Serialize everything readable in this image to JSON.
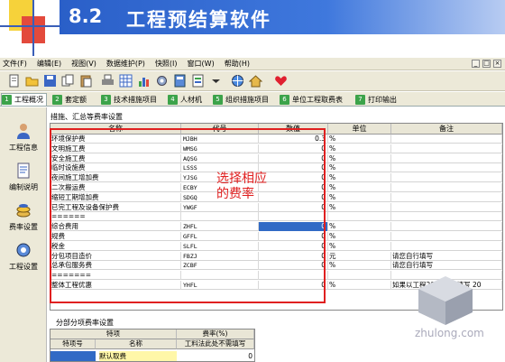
{
  "slide": {
    "number": "8.2",
    "title": "工程预结算软件"
  },
  "menu": [
    "文件(F)",
    "编辑(E)",
    "视图(V)",
    "数据维护(P)",
    "快照(I)",
    "窗口(W)",
    "帮助(H)"
  ],
  "window_controls": [
    "_",
    "□",
    "×"
  ],
  "tabs": [
    {
      "num": "1",
      "label": "工程概况"
    },
    {
      "num": "2",
      "label": "套定额"
    },
    {
      "num": "3",
      "label": "技术措施项目"
    },
    {
      "num": "4",
      "label": "人材机"
    },
    {
      "num": "5",
      "label": "组织措施项目"
    },
    {
      "num": "6",
      "label": "单位工程取费表"
    },
    {
      "num": "7",
      "label": "打印输出"
    }
  ],
  "sidebar": [
    "工程信息",
    "编制说明",
    "费率设置",
    "工程设置"
  ],
  "panel_title": "措施、汇总等费率设置",
  "table": {
    "headers": [
      "名称",
      "代号",
      "数值",
      "单位",
      "备注"
    ],
    "rows": [
      {
        "name": "环境保护费",
        "code": "MJBH",
        "rate": "0.3",
        "unit": "%",
        "note": ""
      },
      {
        "name": "文明施工费",
        "code": "WMSG",
        "rate": "0",
        "unit": "%",
        "note": ""
      },
      {
        "name": "安全施工费",
        "code": "AQSG",
        "rate": "0",
        "unit": "%",
        "note": ""
      },
      {
        "name": "临时设施费",
        "code": "LSSS",
        "rate": "0",
        "unit": "%",
        "note": ""
      },
      {
        "name": "夜间施工增加费",
        "code": "YJSG",
        "rate": "0",
        "unit": "%",
        "note": ""
      },
      {
        "name": "二次搬运费",
        "code": "ECBY",
        "rate": "0",
        "unit": "%",
        "note": ""
      },
      {
        "name": "缩短工期增加费",
        "code": "SDGQ",
        "rate": "0",
        "unit": "%",
        "note": ""
      },
      {
        "name": "已完工程及设备保护费",
        "code": "YWGF",
        "rate": "0",
        "unit": "%",
        "note": ""
      },
      {
        "name": "======",
        "code": "",
        "rate": "",
        "unit": "",
        "note": ""
      },
      {
        "name": "综合费用",
        "code": "ZHFL",
        "rate": "0",
        "unit": "%",
        "note": ""
      },
      {
        "name": "规费",
        "code": "GFFL",
        "rate": "0",
        "unit": "%",
        "note": ""
      },
      {
        "name": "税金",
        "code": "SLFL",
        "rate": "0",
        "unit": "%",
        "note": ""
      },
      {
        "name": "分包项目造价",
        "code": "FBZJ",
        "rate": "0",
        "unit": "元",
        "note": "请您自行填写"
      },
      {
        "name": "总承包服务费",
        "code": "ZCBF",
        "rate": "0",
        "unit": "%",
        "note": "请您自行填写"
      },
      {
        "name": "=======",
        "code": "",
        "rate": "",
        "unit": "",
        "note": ""
      },
      {
        "name": "整体工程优惠",
        "code": "YHFL",
        "rate": "0",
        "unit": "%",
        "note": "如果以工程2006一并填写 20"
      }
    ]
  },
  "annotation": "选择相应的费率",
  "bottom": {
    "title": "分部分项费率设置",
    "headers": [
      "特项",
      "费率(%)",
      "特项号",
      "名称",
      "工料法此处不需填写"
    ],
    "row": {
      "name": "默认取费",
      "rate": "0"
    }
  },
  "watermark": "zhulong.com",
  "colors": {
    "accent": "#316ac5",
    "highlight": "#e02020",
    "tab_num": "#3ca34a",
    "banner": "#2a5fc8"
  }
}
